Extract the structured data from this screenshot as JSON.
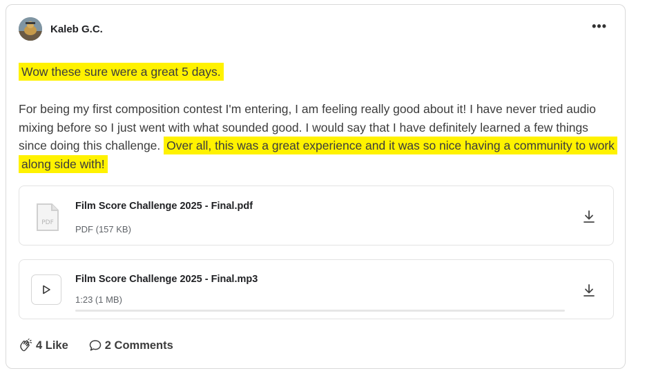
{
  "post": {
    "author": "Kaleb G.C.",
    "more_label": "•••",
    "paragraph1": "Wow these sure were a great 5 days.",
    "paragraph2_plain": "For being my first composition contest I'm entering, I am feeling really good about it! I have never tried audio mixing before so I just went with what sounded good. I would say that I have definitely learned a few things since doing this challenge. ",
    "paragraph2_highlight": "Over all, this was a great experience and it was so nice having a community to work along side with!",
    "highlight_color": "#fff200"
  },
  "attachments": [
    {
      "name": "Film Score Challenge 2025 - Final.pdf",
      "meta": "PDF (157 KB)",
      "icon": "pdf-file-icon"
    },
    {
      "name": "Film Score Challenge 2025 - Final.mp3",
      "meta": "1:23 (1 MB)",
      "icon": "play-icon",
      "progress": 0
    }
  ],
  "footer": {
    "likes_label": "4 Like",
    "comments_label": "2 Comments"
  }
}
